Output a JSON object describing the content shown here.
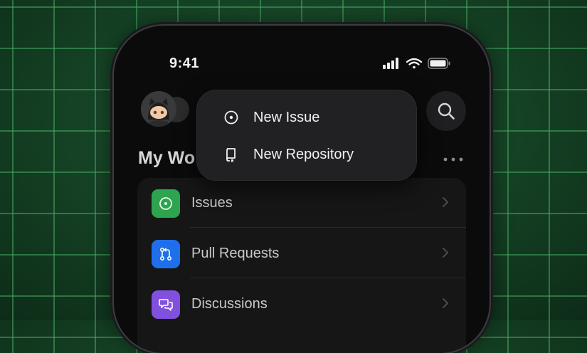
{
  "status_bar": {
    "time": "9:41"
  },
  "header": {
    "title": "My Wo"
  },
  "menu": {
    "items": [
      {
        "label": "New Issue",
        "icon": "issue-opened-icon"
      },
      {
        "label": "New Repository",
        "icon": "repo-icon"
      }
    ]
  },
  "list": {
    "items": [
      {
        "label": "Issues",
        "icon": "issue-opened-icon",
        "color": "#2da44e"
      },
      {
        "label": "Pull Requests",
        "icon": "pull-request-icon",
        "color": "#1f6feb"
      },
      {
        "label": "Discussions",
        "icon": "discussions-icon",
        "color": "#8250df"
      }
    ]
  },
  "colors": {
    "background": "#1a4a2a",
    "grid": "#46aa64",
    "phone": "#0b0b0c",
    "menu": "#222224"
  }
}
